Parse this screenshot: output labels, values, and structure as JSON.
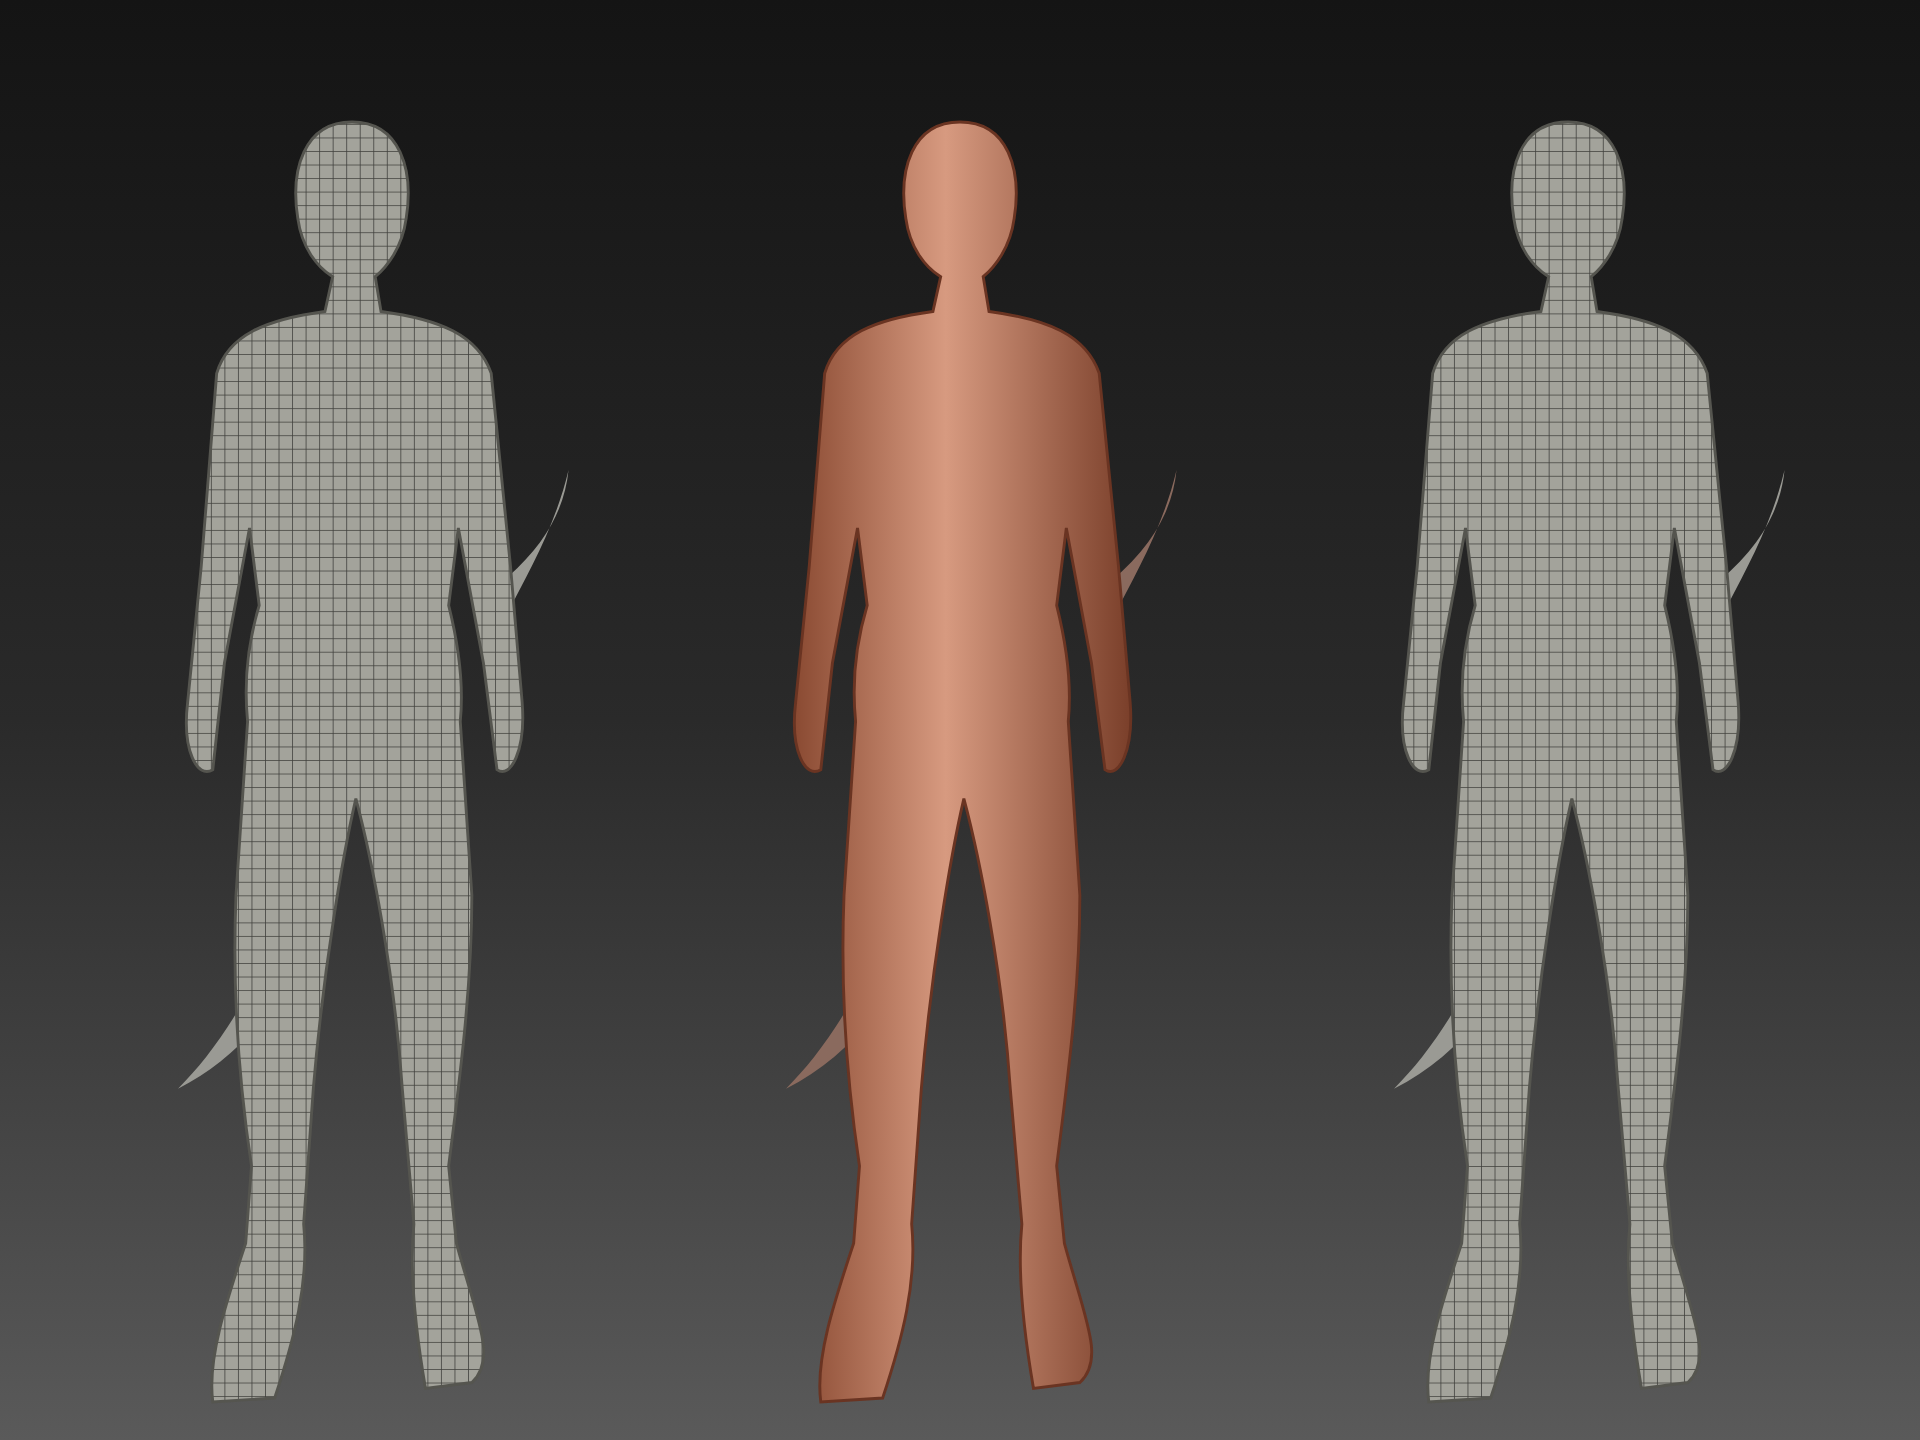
{
  "figures": [
    {
      "kind": "wireframe"
    },
    {
      "kind": "shaded"
    },
    {
      "kind": "wireframe"
    }
  ]
}
